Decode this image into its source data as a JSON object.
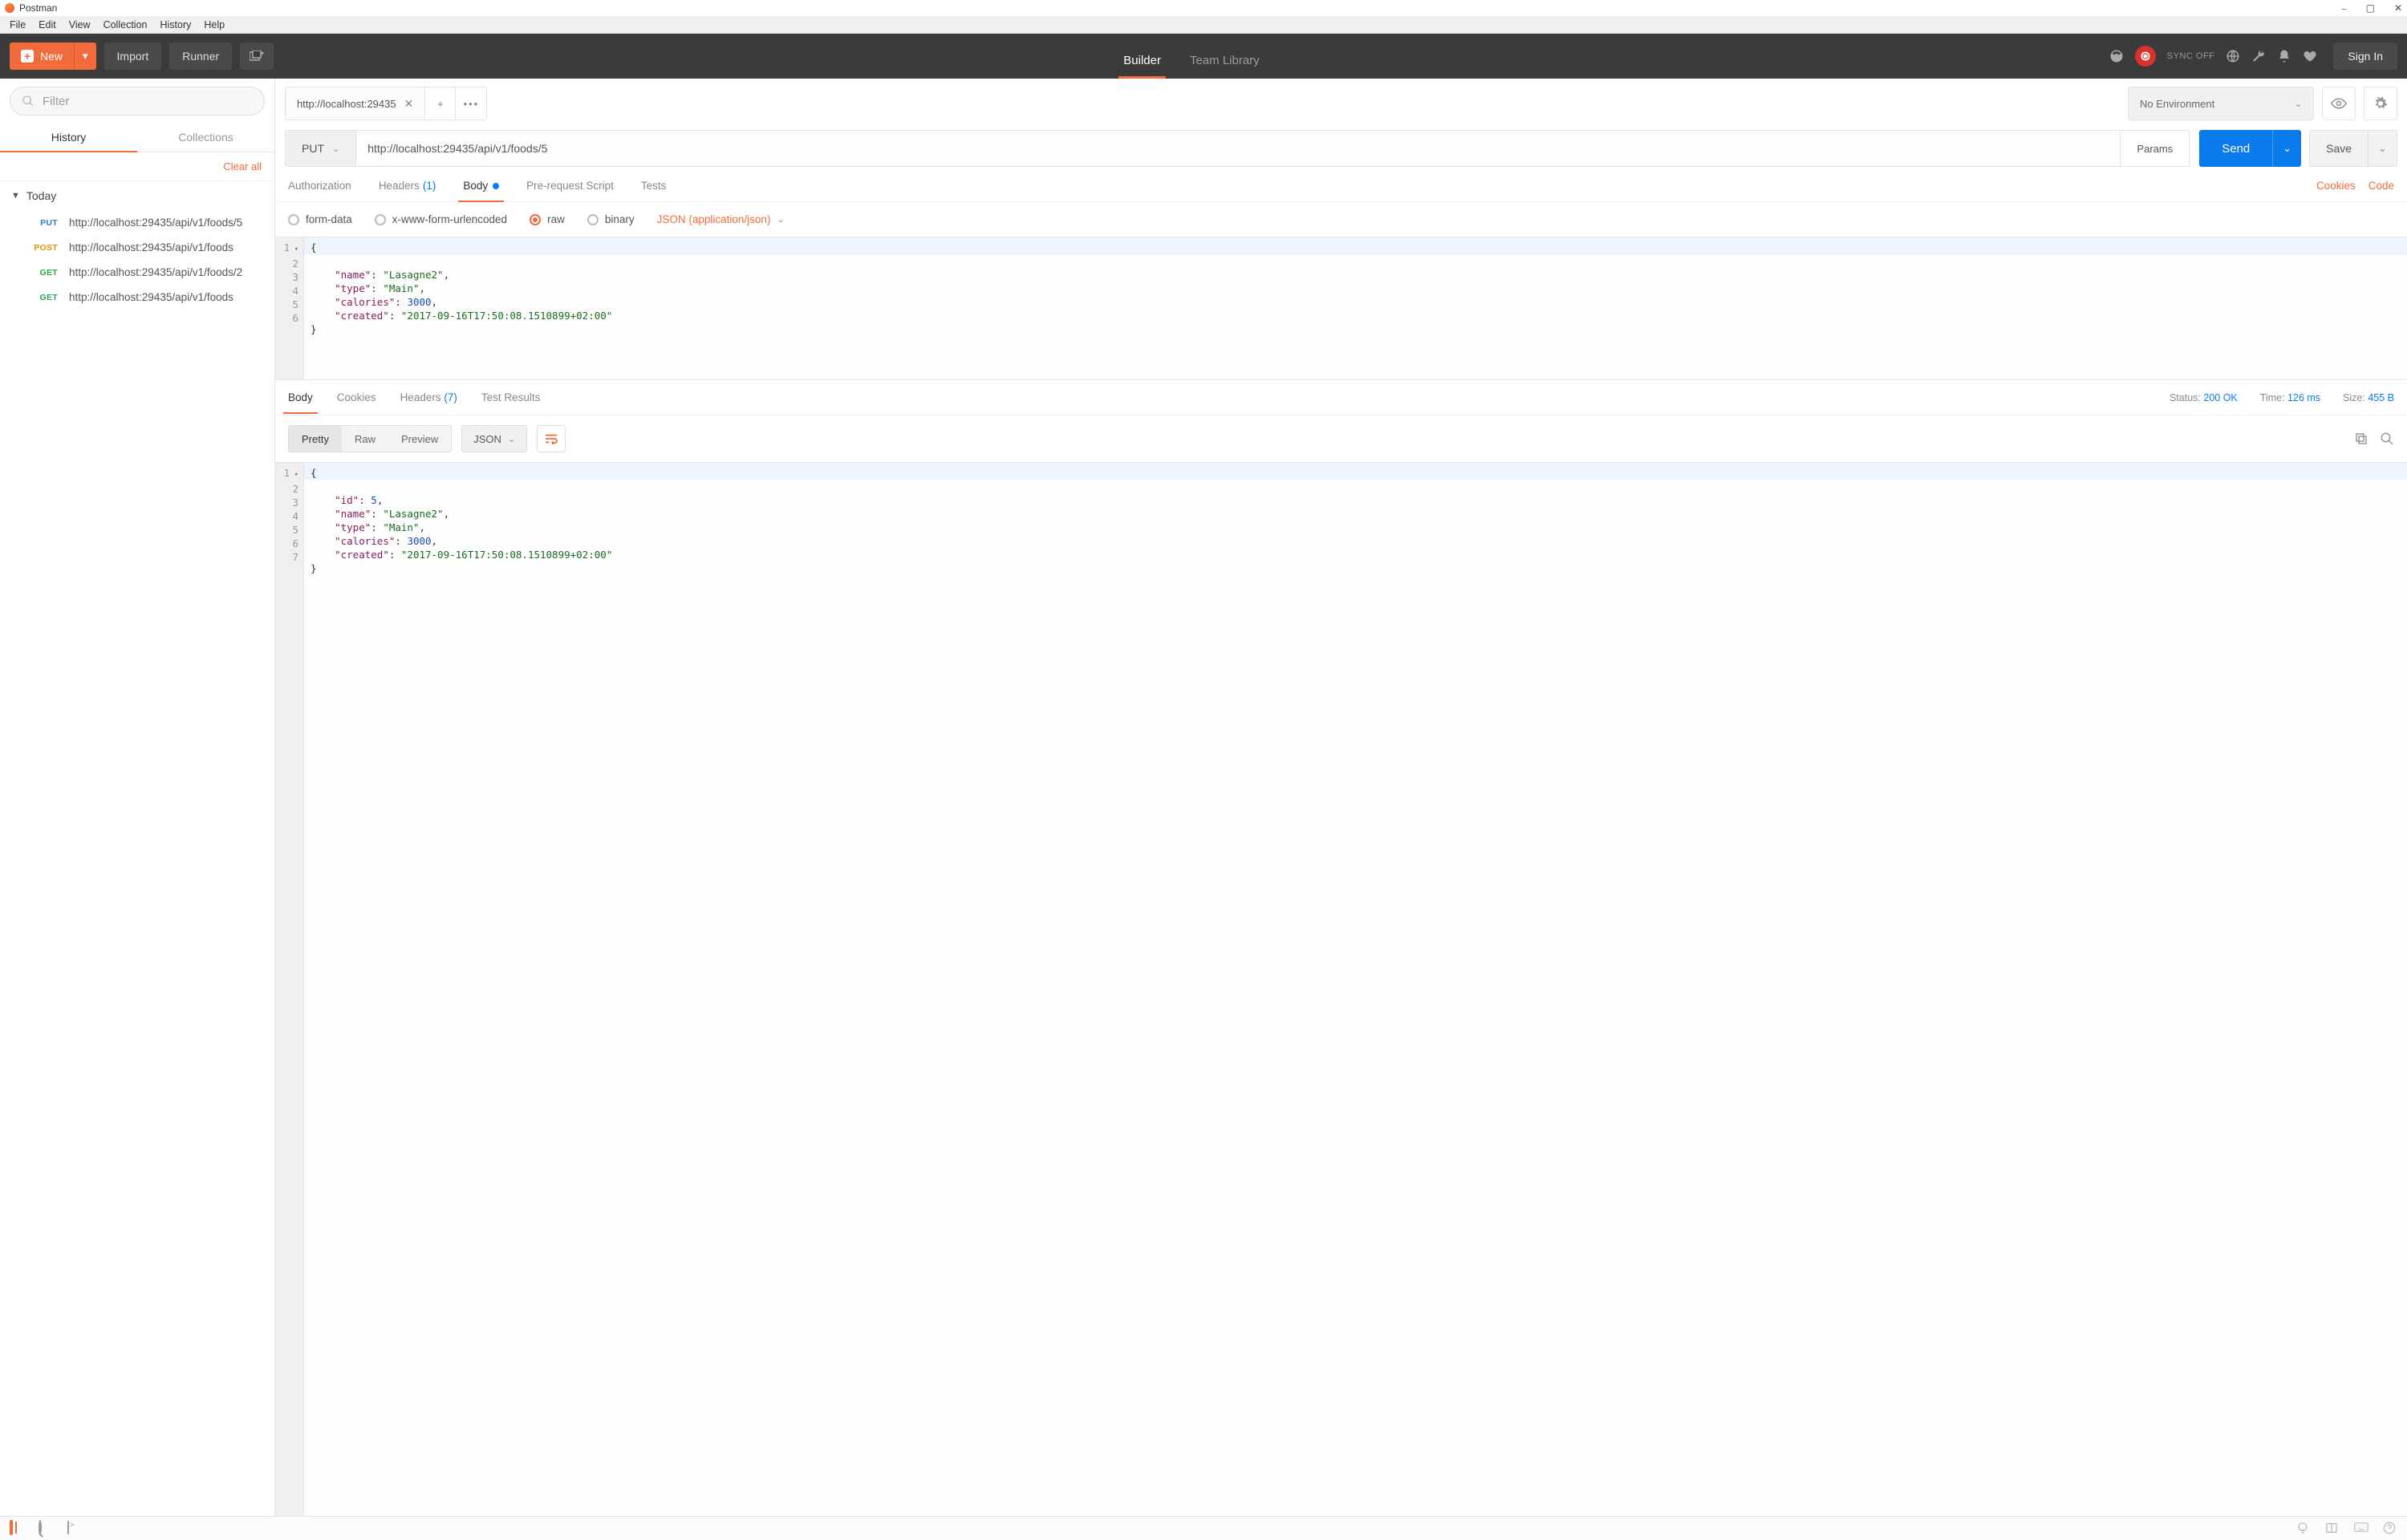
{
  "window": {
    "title": "Postman"
  },
  "menu": {
    "items": [
      "File",
      "Edit",
      "View",
      "Collection",
      "History",
      "Help"
    ]
  },
  "toolbar": {
    "new": "New",
    "import": "Import",
    "runner": "Runner",
    "builder": "Builder",
    "team_library": "Team Library",
    "sync": "SYNC OFF",
    "sign_in": "Sign In"
  },
  "sidebar": {
    "filter_placeholder": "Filter",
    "tabs": {
      "history": "History",
      "collections": "Collections"
    },
    "clear_all": "Clear all",
    "section": "Today",
    "items": [
      {
        "method": "PUT",
        "url": "http://localhost:29435/api/v1/foods/5"
      },
      {
        "method": "POST",
        "url": "http://localhost:29435/api/v1/foods"
      },
      {
        "method": "GET",
        "url": "http://localhost:29435/api/v1/foods/2"
      },
      {
        "method": "GET",
        "url": "http://localhost:29435/api/v1/foods"
      }
    ]
  },
  "request": {
    "tab_title": "http://localhost:29435",
    "env": "No Environment",
    "method": "PUT",
    "url": "http://localhost:29435/api/v1/foods/5",
    "params": "Params",
    "send": "Send",
    "save": "Save",
    "subtabs": {
      "auth": "Authorization",
      "headers": "Headers",
      "headers_count": "(1)",
      "body": "Body",
      "prereq": "Pre-request Script",
      "tests": "Tests"
    },
    "links": {
      "cookies": "Cookies",
      "code": "Code"
    },
    "body_types": {
      "form": "form-data",
      "urlenc": "x-www-form-urlencoded",
      "raw": "raw",
      "binary": "binary",
      "content": "JSON (application/json)"
    },
    "body_json": {
      "name": "Lasagne2",
      "type": "Main",
      "calories": 3000,
      "created": "2017-09-16T17:50:08.1510899+02:00"
    }
  },
  "response": {
    "tabs": {
      "body": "Body",
      "cookies": "Cookies",
      "headers": "Headers",
      "headers_count": "(7)",
      "tests": "Test Results"
    },
    "status_label": "Status:",
    "status_value": "200 OK",
    "time_label": "Time:",
    "time_value": "126 ms",
    "size_label": "Size:",
    "size_value": "455 B",
    "view": {
      "pretty": "Pretty",
      "raw": "Raw",
      "preview": "Preview"
    },
    "format": "JSON",
    "body_json": {
      "id": 5,
      "name": "Lasagne2",
      "type": "Main",
      "calories": 3000,
      "created": "2017-09-16T17:50:08.1510899+02:00"
    }
  }
}
